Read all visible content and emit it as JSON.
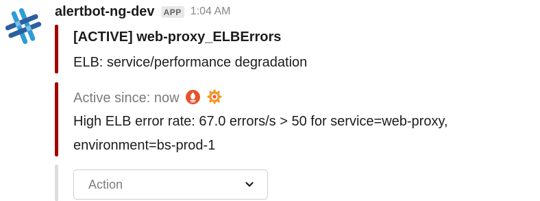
{
  "message": {
    "sender": "alertbot-ng-dev",
    "badge": "APP",
    "timestamp": "1:04 AM",
    "avatar_icon": "slack-hash-logo-icon"
  },
  "attachment_1": {
    "color": "#a30200",
    "title": "[ACTIVE] web-proxy_ELBErrors",
    "text": "ELB: service/performance degradation"
  },
  "attachment_2": {
    "color": "#a30200",
    "active_since": "Active since: now",
    "icons": [
      "prometheus-icon",
      "grafana-icon"
    ],
    "description_line1": "High ELB error rate: 67.0 errors/s > 50 for service=web-proxy,",
    "description_line2": "environment=bs-prod-1"
  },
  "actions": {
    "bar_color": "#dddddd",
    "select_placeholder": "Action",
    "select_icon": "chevron-down-icon"
  }
}
